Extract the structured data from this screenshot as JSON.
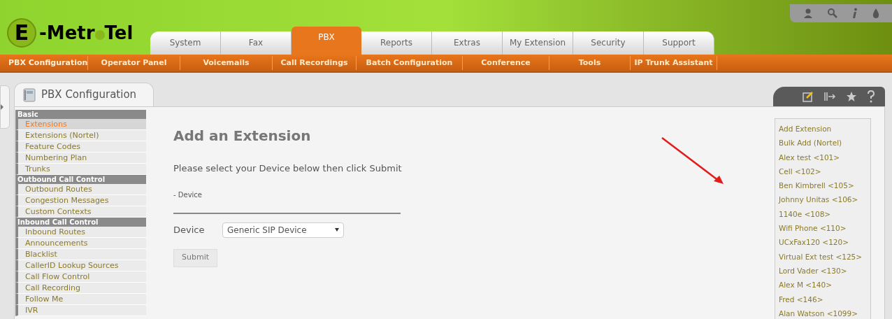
{
  "logo": {
    "letter": "E",
    "part_1": "-Metr",
    "part_2": "Tel"
  },
  "main_tabs": [
    {
      "label": "System",
      "selected": false
    },
    {
      "label": "Fax",
      "selected": false
    },
    {
      "label": "PBX",
      "selected": true
    },
    {
      "label": "Reports",
      "selected": false
    },
    {
      "label": "Extras",
      "selected": false
    },
    {
      "label": "My Extension",
      "selected": false
    },
    {
      "label": "Security",
      "selected": false
    },
    {
      "label": "Support",
      "selected": false
    }
  ],
  "sub_menu": [
    {
      "label": "PBX Configuration",
      "selected": true
    },
    {
      "label": "Operator Panel",
      "selected": false
    },
    {
      "label": "Voicemails",
      "selected": false
    },
    {
      "label": "Call Recordings",
      "selected": false
    },
    {
      "label": "Batch Configuration",
      "selected": false
    },
    {
      "label": "Conference",
      "selected": false
    },
    {
      "label": "Tools",
      "selected": false
    },
    {
      "label": "IP Trunk Assistant",
      "selected": false
    }
  ],
  "panel_tab": {
    "title": "PBX Configuration"
  },
  "sidebar": [
    {
      "heading": "Basic",
      "items": [
        {
          "label": "Extensions",
          "selected": true
        },
        {
          "label": "Extensions (Nortel)",
          "selected": false
        },
        {
          "label": "Feature Codes",
          "selected": false
        },
        {
          "label": "Numbering Plan",
          "selected": false
        },
        {
          "label": "Trunks",
          "selected": false
        }
      ]
    },
    {
      "heading": "Outbound Call Control",
      "items": [
        {
          "label": "Outbound Routes",
          "selected": false
        },
        {
          "label": "Congestion Messages",
          "selected": false
        },
        {
          "label": "Custom Contexts",
          "selected": false
        }
      ]
    },
    {
      "heading": "Inbound Call Control",
      "items": [
        {
          "label": "Inbound Routes",
          "selected": false
        },
        {
          "label": "Announcements",
          "selected": false
        },
        {
          "label": "Blacklist",
          "selected": false
        },
        {
          "label": "CallerID Lookup Sources",
          "selected": false
        },
        {
          "label": "Call Flow Control",
          "selected": false
        },
        {
          "label": "Call Recording",
          "selected": false
        },
        {
          "label": "Follow Me",
          "selected": false
        },
        {
          "label": "IVR",
          "selected": false
        }
      ]
    }
  ],
  "form": {
    "title": "Add an Extension",
    "instruction": "Please select your Device below then click Submit",
    "section": "- Device",
    "device_label": "Device",
    "device_value": "Generic SIP Device",
    "submit": "Submit"
  },
  "extension_list": [
    "Add Extension",
    "Bulk Add (Nortel)",
    "Alex test <101>",
    "Cell <102>",
    "Ben Kimbrell <105>",
    "Johnny Unitas <106>",
    "1140e <108>",
    "Wifi Phone <110>",
    "UCxFax120 <120>",
    "Virtual Ext test <125>",
    "Lord Vader <130>",
    "Alex M <140>",
    "Fred <146>",
    "Alan Watson <1099>"
  ]
}
